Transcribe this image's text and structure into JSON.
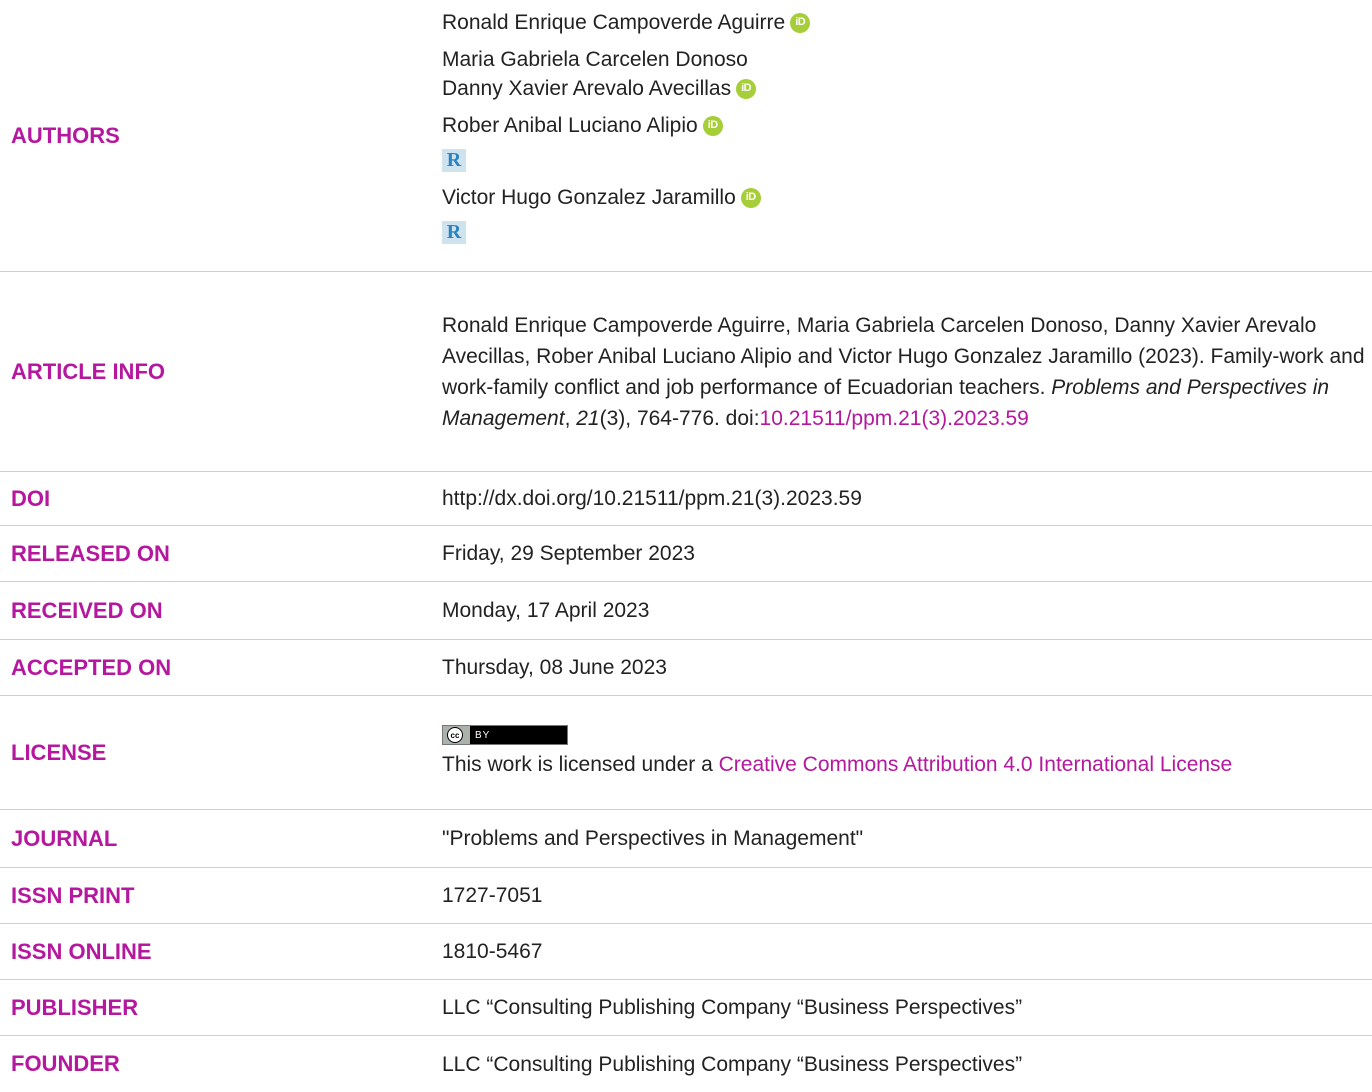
{
  "rows": {
    "authors": {
      "label": "AUTHORS",
      "list": [
        "Ronald Enrique Campoverde Aguirre",
        "Maria Gabriela Carcelen Donoso",
        "Danny Xavier Arevalo Avecillas",
        "Rober Anibal Luciano Alipio",
        "Victor Hugo Gonzalez Jaramillo"
      ],
      "orcid_icon_text": "iD",
      "researchgate_icon_text": "R"
    },
    "article_info": {
      "label": "ARTICLE INFO",
      "citation_text": "Ronald Enrique Campoverde Aguirre, Maria Gabriela Carcelen Donoso, Danny Xavier Arevalo Avecillas, Rober Anibal Luciano Alipio and Victor Hugo Gonzalez Jaramillo (2023). Family-work and work-family conflict and job performance of Ecuadorian teachers. ",
      "journal_italic": "Problems and Perspectives in Management",
      "sep1": ", ",
      "volume_italic": "21",
      "issue_pages": "(3), 764-776. doi:",
      "doi_link": "10.21511/ppm.21(3).2023.59"
    },
    "doi": {
      "label": "DOI",
      "value": "http://dx.doi.org/10.21511/ppm.21(3).2023.59"
    },
    "released_on": {
      "label": "RELEASED ON",
      "value": "Friday, 29 September 2023"
    },
    "received_on": {
      "label": "RECEIVED ON",
      "value": "Monday, 17 April 2023"
    },
    "accepted_on": {
      "label": "ACCEPTED ON",
      "value": "Thursday, 08 June 2023"
    },
    "license": {
      "label": "LICENSE",
      "badge_cc": "cc",
      "badge_by": "BY",
      "text_prefix": "This work is licensed under a ",
      "link_text": "Creative Commons Attribution 4.0 International License"
    },
    "journal": {
      "label": "JOURNAL",
      "value": "\"Problems and Perspectives in Management\""
    },
    "issn_print": {
      "label": "ISSN PRINT",
      "value": "1727-7051"
    },
    "issn_online": {
      "label": "ISSN ONLINE",
      "value": "1810-5467"
    },
    "publisher": {
      "label": "PUBLISHER",
      "value": "LLC “Consulting Publishing Company “Business Perspectives”"
    },
    "founder": {
      "label": "FOUNDER",
      "value": "LLC “Consulting Publishing Company “Business Perspectives”"
    }
  }
}
